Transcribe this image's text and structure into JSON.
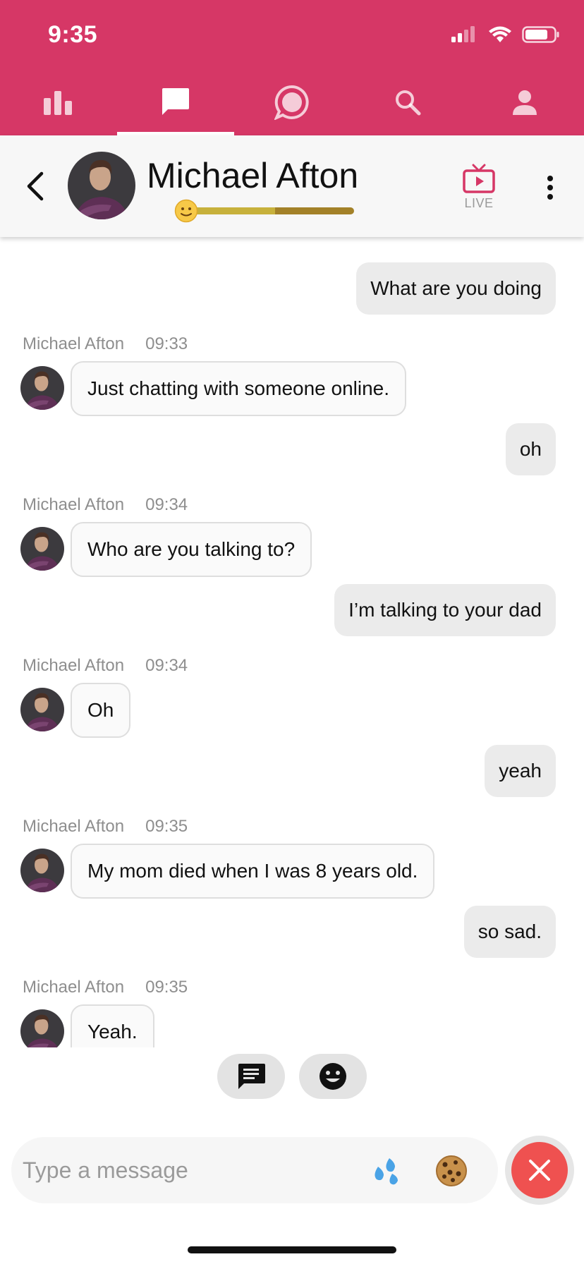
{
  "status_bar": {
    "time": "9:35"
  },
  "nav_tabs": [
    {
      "name": "stats",
      "icon": "bar-chart-icon"
    },
    {
      "name": "chat",
      "icon": "chat-square-icon",
      "active": true
    },
    {
      "name": "discuss",
      "icon": "chat-round-icon"
    },
    {
      "name": "search",
      "icon": "search-icon"
    },
    {
      "name": "profile",
      "icon": "person-icon"
    }
  ],
  "chat_header": {
    "name": "Michael Afton",
    "mood_emoji": "🙂",
    "mood_level": 0.53,
    "live_label": "LIVE"
  },
  "messages": [
    {
      "from": "me",
      "text": "What are you doing"
    },
    {
      "from": "bot",
      "sender": "Michael Afton",
      "time": "09:33",
      "text": "Just chatting with someone online."
    },
    {
      "from": "me",
      "text": "oh"
    },
    {
      "from": "bot",
      "sender": "Michael Afton",
      "time": "09:34",
      "text": "Who are you talking to?"
    },
    {
      "from": "me",
      "text": "I’m talking to your dad"
    },
    {
      "from": "bot",
      "sender": "Michael Afton",
      "time": "09:34",
      "text": "Oh"
    },
    {
      "from": "me",
      "text": "yeah"
    },
    {
      "from": "bot",
      "sender": "Michael Afton",
      "time": "09:35",
      "text": "My mom died when I was 8 years old."
    },
    {
      "from": "me",
      "text": "so sad."
    },
    {
      "from": "bot",
      "sender": "Michael Afton",
      "time": "09:35",
      "text": "Yeah."
    }
  ],
  "quick_actions": [
    {
      "name": "message-suggestions",
      "icon": "message-icon"
    },
    {
      "name": "emoji-reactions",
      "icon": "smiley-icon"
    }
  ],
  "composer": {
    "placeholder": "Type a message",
    "value": "",
    "icons": [
      "sweat-droplets-icon",
      "cookie-icon"
    ]
  },
  "colors": {
    "brand": "#d63766",
    "close_button": "#ef5150",
    "incoming_bubble": "#fafafa",
    "outgoing_bubble": "#ebebeb"
  }
}
